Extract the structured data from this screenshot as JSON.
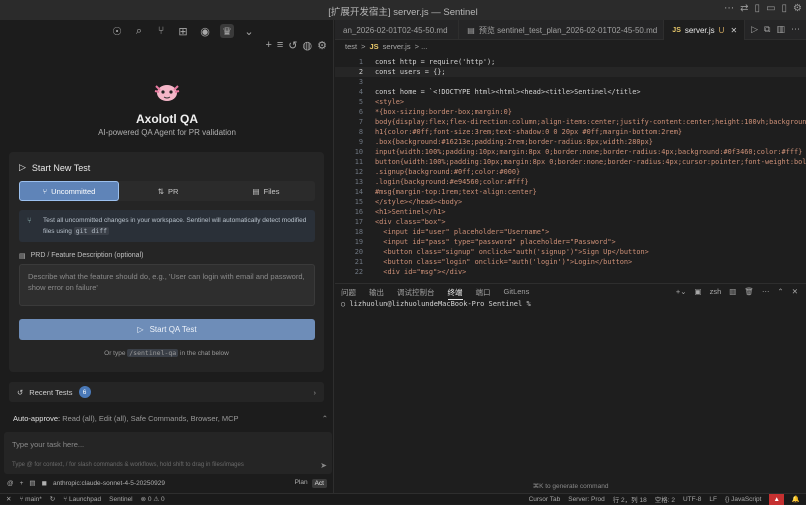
{
  "window": {
    "title": "[扩展开发宿主] server.js — Sentinel"
  },
  "left": {
    "app_name": "Axolotl QA",
    "app_desc": "AI-powered QA Agent for PR validation",
    "start_title": "Start New Test",
    "modes": [
      "Uncommitted",
      "PR",
      "Files"
    ],
    "info_text": "Test all uncommitted changes in your workspace. Sentinel will automatically detect modified files using",
    "info_code": "git diff",
    "pr_label": "PRD / Feature Description (optional)",
    "pr_placeholder": "Describe what the feature should do, e.g., 'User can login with email and password, show error on failure'",
    "start_button": "Start QA Test",
    "or_type_pre": "Or type",
    "or_type_cmd": "/sentinel-qa",
    "or_type_post": "in the chat below",
    "recent_label": "Recent Tests",
    "recent_count": "6",
    "auto_label": "Auto-approve:",
    "auto_value": "Read (all), Edit (all), Safe Commands, Browser, MCP",
    "chat_placeholder": "Type your task here...",
    "chat_hint": "Type @ for context, / for slash commands & workflows, hold shift to drag in files/images",
    "model": "anthropic:claude-sonnet-4-5-20250929",
    "plan": "Plan",
    "act": "Act"
  },
  "tabs": [
    {
      "label": "an_2026-02-01T02-45-50.md"
    },
    {
      "label": "预览 sentinel_test_plan_2026-02-01T02-45-50.md"
    },
    {
      "label": "server.js",
      "badge": "U",
      "active": true
    }
  ],
  "breadcrumb": {
    "folder": "test",
    "sep": ">",
    "file": "server.js",
    "tail": "> ..."
  },
  "code_lines": [
    "1",
    "2",
    "3",
    "4",
    "5",
    "6",
    "7",
    "8",
    "9",
    "10",
    "11",
    "12",
    "13",
    "14",
    "15",
    "16",
    "17",
    "18",
    "19",
    "20",
    "21",
    "22"
  ],
  "code": {
    "l1": "const http = require('http');",
    "l2": "const users = {};",
    "l4": "const home = `<!DOCTYPE html><html><head><title>Sentinel</title>",
    "l5": "<style>",
    "l6": "*{box-sizing:border-box;margin:0}",
    "l7": "body{display:flex;flex-direction:column;align-items:center;justify-content:center;height:100vh;background:#",
    "l8": "h1{color:#0ff;font-size:3rem;text-shadow:0 0 20px #0ff;margin-bottom:2rem}",
    "l9": ".box{background:#16213e;padding:2rem;border-radius:8px;width:280px}",
    "l10": "input{width:100%;padding:10px;margin:8px 0;border:none;border-radius:4px;background:#0f3460;color:#fff}",
    "l11": "button{width:100%;padding:10px;margin:8px 0;border:none;border-radius:4px;cursor:pointer;font-weight:bold}",
    "l12": ".signup{background:#0ff;color:#000}",
    "l13": ".login{background:#e94560;color:#fff}",
    "l14": "#msg{margin-top:1rem;text-align:center}",
    "l15": "</style></head><body>",
    "l16": "<h1>Sentinel</h1>",
    "l17": "<div class=\"box\">",
    "l18": "  <input id=\"user\" placeholder=\"Username\">",
    "l19": "  <input id=\"pass\" type=\"password\" placeholder=\"Password\">",
    "l20": "  <button class=\"signup\" onclick=\"auth('signup')\">Sign Up</button>",
    "l21": "  <button class=\"login\" onclick=\"auth('login')\">Login</button>",
    "l22": "  <div id=\"msg\"></div>"
  },
  "panel": {
    "tabs": [
      "问题",
      "输出",
      "调试控制台",
      "终端",
      "端口",
      "GitLens"
    ],
    "shell": "zsh",
    "prompt": "lizhuolun@lizhuolundeMacBook-Pro Sentinel %",
    "gen_hint": "⌘K to generate command"
  },
  "status": {
    "branch": "main*",
    "launchpad": "Launchpad",
    "project": "Sentinel",
    "problems": "⊗ 0 ⚠ 0",
    "cursor_tab": "Cursor Tab",
    "server": "Server: Prod",
    "position": "行 2，列 18",
    "spaces": "空格: 2",
    "encoding": "UTF-8",
    "eol": "LF",
    "lang": "JavaScript"
  }
}
